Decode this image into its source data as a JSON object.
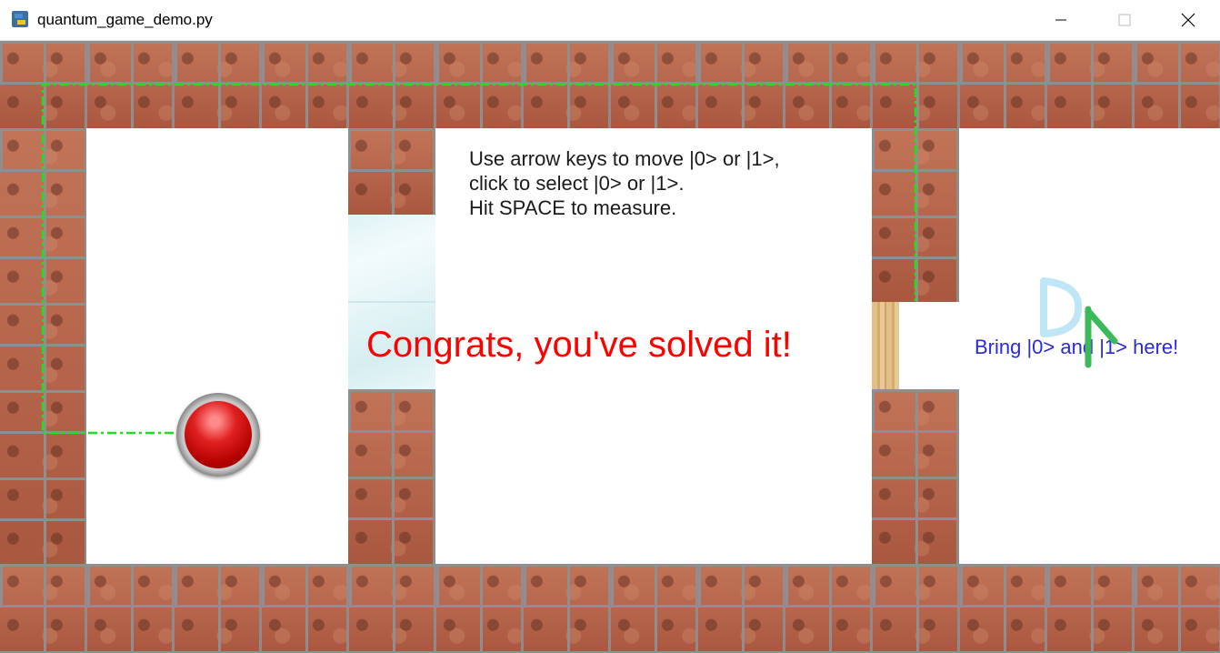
{
  "window": {
    "title": "quantum_game_demo.py",
    "icons": [
      "python-icon",
      "minimize-icon",
      "maximize-icon",
      "close-icon"
    ]
  },
  "game": {
    "instructions": [
      "Use arrow keys to move |0> or |1>,",
      "click to select |0> or |1>.",
      "Hit SPACE to measure."
    ],
    "congrats": "Congrats, you've solved it!",
    "goal_text": "Bring |0> and |1> here!",
    "colors": {
      "congrats": "#ff0000",
      "goal_text": "#2a2ad8",
      "path": "#1ee01e",
      "brick": "#b5644a",
      "state0": "#bfe6f7",
      "state1": "#3cba5a"
    },
    "tiles": [
      "brick-wall",
      "glass-panel",
      "wooden-door",
      "red-button"
    ]
  }
}
